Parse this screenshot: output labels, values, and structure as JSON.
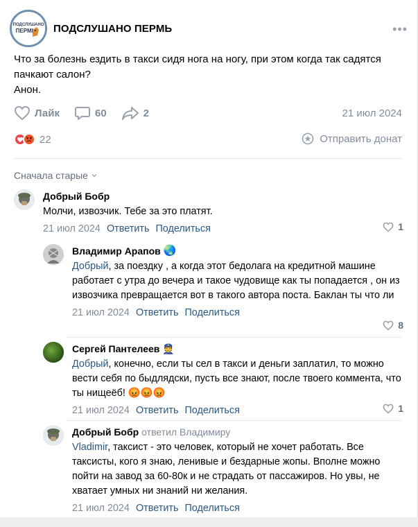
{
  "group": {
    "name": "ПОДСЛУШАНО ПЕРМЬ",
    "logo_text": "ПОДСЛУШАНО",
    "logo_sub": "ПЕРМЬ"
  },
  "post": {
    "text_line1": "Что за болезнь ездить в такси сидя нога на ногу, при этом когда так садятся",
    "text_line2": "пачкают салон?",
    "text_line3": "Анон.",
    "like_label": "Лайк",
    "comments_count": "60",
    "shares_count": "2",
    "date": "21 июл 2024",
    "reactions_count": "22",
    "donate_label": "Отправить донат"
  },
  "comments_sort": "Сначала старые",
  "comments": [
    {
      "author": "Добрый Бобр",
      "text": "Молчи, извозчик. Тебе за это платят.",
      "date": "21 июл 2024",
      "reply": "Ответить",
      "share": "Поделиться",
      "likes": "1"
    },
    {
      "author": "Владимир Арапов",
      "author_emoji": "🌏",
      "mention": "Добрый",
      "text": ", за поездку , а когда этот бедолага на кредитной машине работает с утра до вечера и такое чудовище как ты попадается , он из извозчика превращается вот в такого автора поста. Баклан ты что ли",
      "date": "21 июл 2024",
      "reply": "Ответить",
      "share": "Поделиться",
      "likes": "8"
    },
    {
      "author": "Сергей Пантелеев",
      "author_emoji": "👮",
      "mention": "Добрый",
      "text": ", конечно, если ты сел в такси и деньги заплатил, то можно вести себя по быдлядски, пусть все знают, после твоего коммента, что ты нищеёб! 😡😡😡",
      "date": "21 июл 2024",
      "reply": "Ответить",
      "share": "Поделиться",
      "likes": "1"
    },
    {
      "author": "Добрый Бобр",
      "reply_to": "ответил Владимиру",
      "mention": "Vladimir",
      "text": ", таксист - это человек, который не хочет работать. Все таксисты, кого я знаю, ленивые и бездарные жопы. Вполне можно пойти на завод за 60-80к и не страдать от пассажиров. Но увы, не хватает умных ни знаний ни желания.",
      "date": "21 июл 2024",
      "reply": "Ответить",
      "share": "Поделиться"
    }
  ],
  "colors": {
    "accent": "#2a5885",
    "secondary": "#818c99",
    "divider": "#e7e8ec",
    "heart": "#e64646"
  }
}
